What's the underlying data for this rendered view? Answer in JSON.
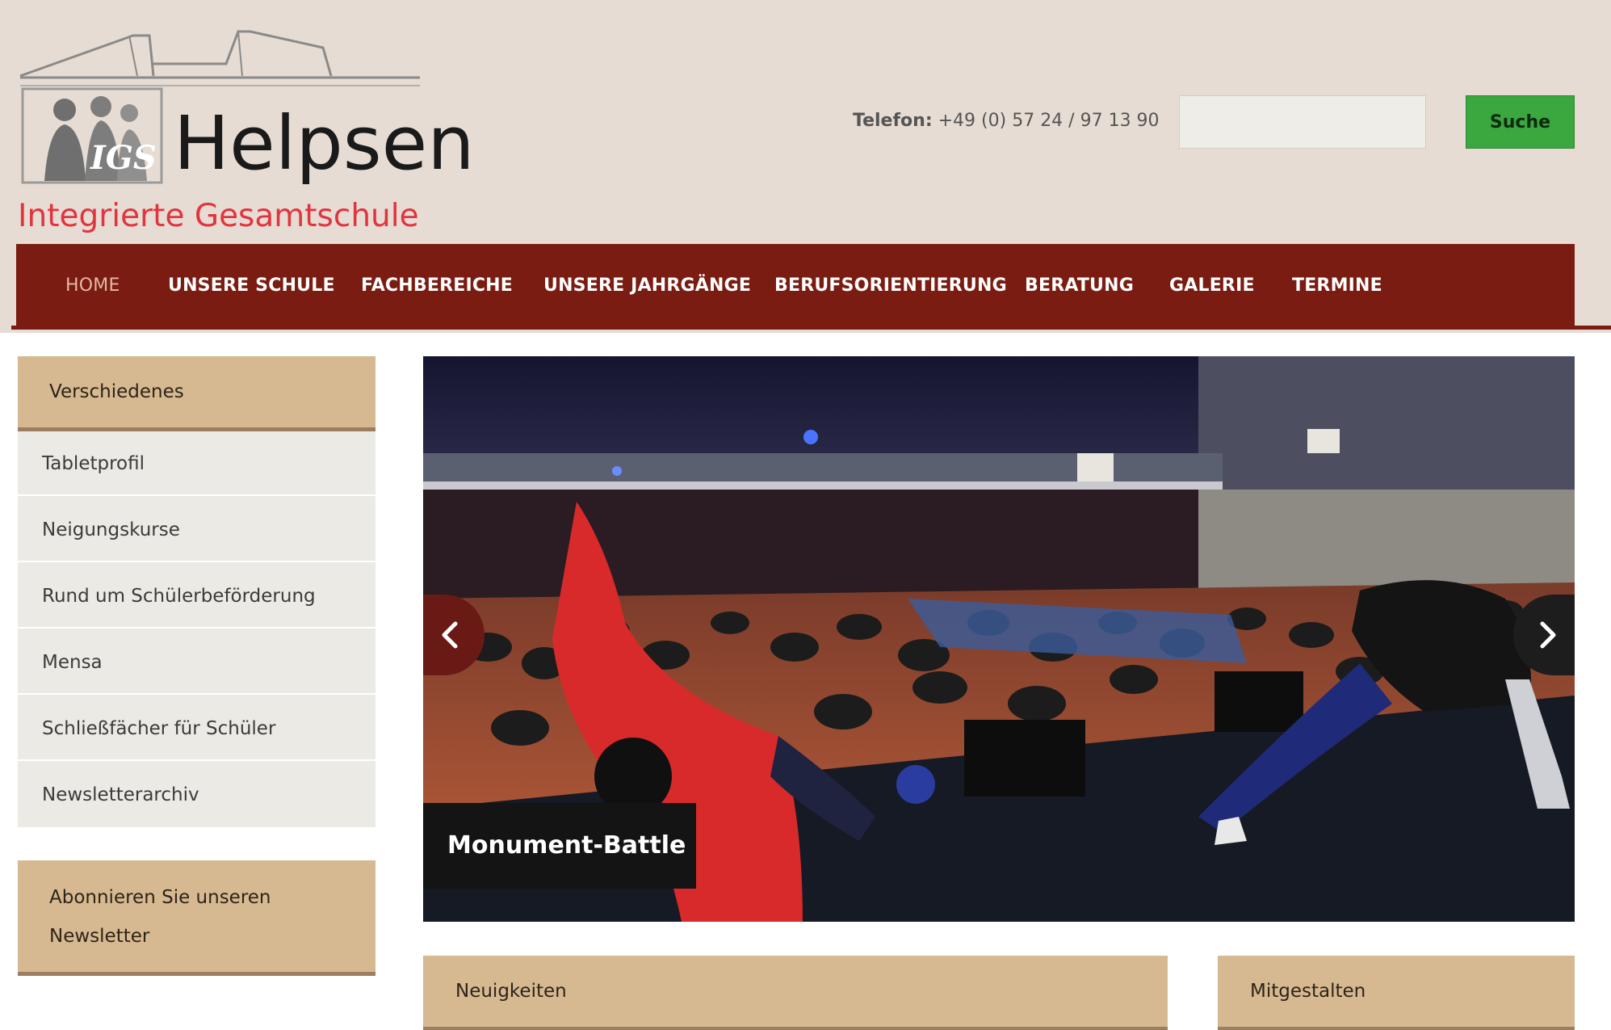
{
  "header": {
    "logo_text": "Helpsen",
    "logo_badge": "IGS",
    "logo_tagline": "Integrierte Gesamtschule",
    "phone_label": "Telefon:",
    "phone_number": "+49 (0) 57 24 / 97 13 90",
    "search": {
      "placeholder": "",
      "value": "",
      "button_label": "Suche"
    }
  },
  "nav": {
    "items": [
      {
        "label": "HOME",
        "active": true
      },
      {
        "label": "UNSERE SCHULE"
      },
      {
        "label": "FACHBEREICHE"
      },
      {
        "label": "UNSERE JAHRGÄNGE"
      },
      {
        "label": "BERUFSORIENTIERUNG"
      },
      {
        "label": "BERATUNG"
      },
      {
        "label": "GALERIE"
      },
      {
        "label": "TERMINE"
      }
    ]
  },
  "sidebar": {
    "heading": "Verschiedenes",
    "items": [
      {
        "label": "Tabletprofil"
      },
      {
        "label": "Neigungskurse"
      },
      {
        "label": "Rund um Schülerbeförderung"
      },
      {
        "label": "Mensa"
      },
      {
        "label": "Schließfächer für Schüler"
      },
      {
        "label": "Newsletterarchiv"
      }
    ],
    "newsletter_heading_line1": "Abonnieren Sie unseren",
    "newsletter_heading_line2": "Newsletter"
  },
  "slider": {
    "caption": "Monument-Battle",
    "prev_icon": "chevron-left-icon",
    "next_icon": "chevron-right-icon"
  },
  "panels": {
    "news_heading": "Neuigkeiten",
    "contribute_heading": "Mitgestalten"
  },
  "colors": {
    "header_bg": "#e6dcd3",
    "nav_bg": "#7a1c12",
    "accent_red": "#e2343f",
    "search_button": "#3aa73f",
    "panel_heading_bg": "#d6b991"
  }
}
